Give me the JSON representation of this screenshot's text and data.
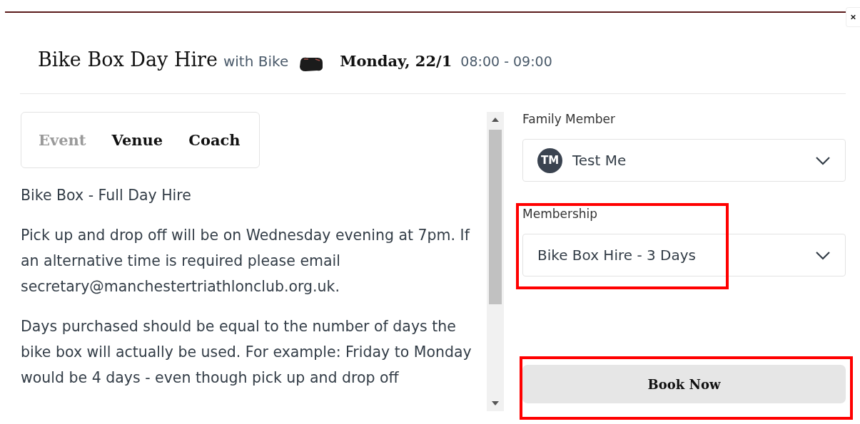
{
  "header": {
    "title": "Bike Box Day Hire",
    "with_text": "with Bike",
    "date": "Monday, 22/1",
    "time": "08:00 - 09:00"
  },
  "tabs": [
    {
      "label": "Event",
      "selected": true
    },
    {
      "label": "Venue",
      "selected": false
    },
    {
      "label": "Coach",
      "selected": false
    }
  ],
  "description": [
    "Bike Box - Full Day Hire",
    "Pick up and drop off will be on Wednesday evening at 7pm. If an alternative time is required please email secretary@manchestertriathlonclub.org.uk.",
    "Days purchased should be equal to the number of days the bike box will actually be used. For example: Friday to Monday would be 4 days - even though pick up and drop off"
  ],
  "family_member": {
    "label": "Family Member",
    "initials": "TM",
    "value": "Test Me"
  },
  "membership": {
    "label": "Membership",
    "value": "Bike Box Hire - 3 Days"
  },
  "book_button": "Book Now"
}
